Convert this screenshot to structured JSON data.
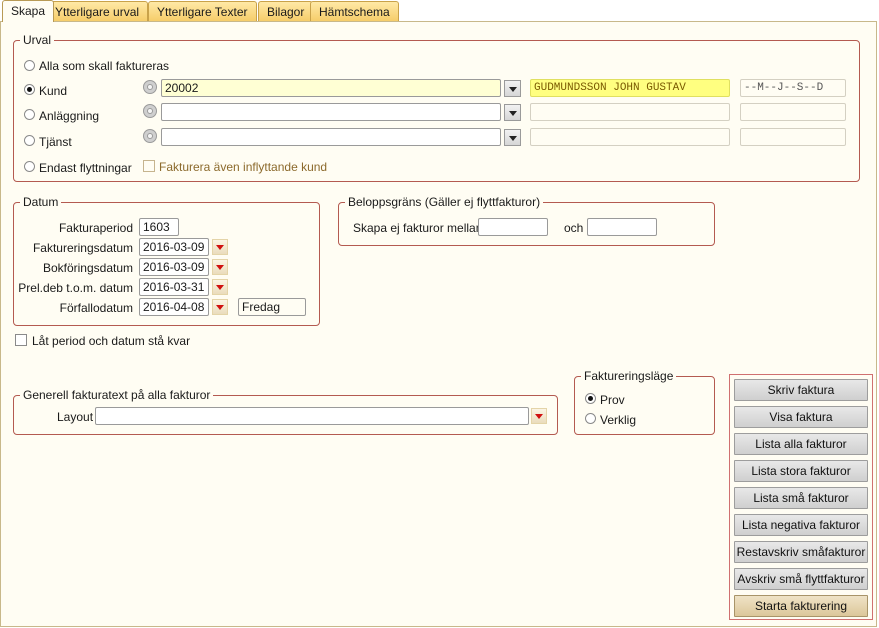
{
  "tabs": [
    {
      "label": "Skapa",
      "active": true
    },
    {
      "label": "Ytterligare urval",
      "active": false
    },
    {
      "label": "Ytterligare Texter",
      "active": false
    },
    {
      "label": "Bilagor",
      "active": false
    },
    {
      "label": "Hämtschema",
      "active": false
    }
  ],
  "urval": {
    "legend": "Urval",
    "alla_label": "Alla som skall faktureras",
    "kund_label": "Kund",
    "anlaggning_label": "Anläggning",
    "tjanst_label": "Tjänst",
    "flytt_label": "Endast flyttningar",
    "kund_value": "20002",
    "kund_name": "GUDMUNDSSON JOHN GUSTAV",
    "kund_code": "--M--J--S--D",
    "anlaggning_value": "",
    "tjanst_value": "",
    "inflyttande_label": "Fakturera även inflyttande kund",
    "selected": "kund"
  },
  "datum": {
    "legend": "Datum",
    "fakturaperiod_label": "Fakturaperiod",
    "fakturaperiod": "1603",
    "faktureringsdatum_label": "Faktureringsdatum",
    "faktureringsdatum": "2016-03-09",
    "bokforingsdatum_label": "Bokföringsdatum",
    "bokforingsdatum": "2016-03-09",
    "preldeb_label": "Prel.deb t.o.m. datum",
    "preldeb": "2016-03-31",
    "forfallodatum_label": "Förfallodatum",
    "forfallodatum": "2016-04-08",
    "weekday": "Fredag"
  },
  "belopp": {
    "legend": "Beloppsgräns (Gäller ej flyttfakturor)",
    "label": "Skapa ej fakturor mellan",
    "och": "och",
    "from": "",
    "to": ""
  },
  "lat_period_label": "Låt period och datum stå kvar",
  "fakturatext": {
    "legend": "Generell fakturatext på alla fakturor",
    "layout_label": "Layout",
    "layout_value": ""
  },
  "lage": {
    "legend": "Faktureringsläge",
    "prov": "Prov",
    "verklig": "Verklig",
    "selected": "prov"
  },
  "buttons": {
    "skriv": "Skriv faktura",
    "visa": "Visa faktura",
    "lista_alla": "Lista alla fakturor",
    "lista_stora": "Lista stora fakturor",
    "lista_sma": "Lista små fakturor",
    "lista_negativa": "Lista negativa fakturor",
    "restavskriv": "Restavskriv småfakturor",
    "avskriv_flytt": "Avskriv små flyttfakturor",
    "starta": "Starta fakturering"
  },
  "colors": {
    "group_border": "#b45a50",
    "page_bg": "#fffdf3",
    "tab_bg": "#f6cd6a",
    "name_highlight": "#ffff80"
  }
}
